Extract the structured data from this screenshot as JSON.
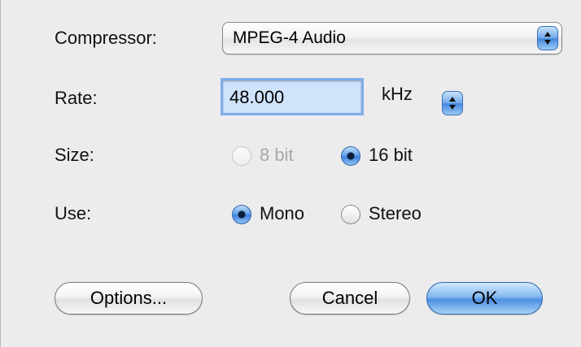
{
  "compressor": {
    "label": "Compressor:",
    "value": "MPEG-4 Audio"
  },
  "rate": {
    "label": "Rate:",
    "value": "48.000",
    "unit": "kHz"
  },
  "size": {
    "label": "Size:",
    "options": [
      {
        "label": "8 bit",
        "selected": false,
        "enabled": false
      },
      {
        "label": "16 bit",
        "selected": true,
        "enabled": true
      }
    ]
  },
  "use": {
    "label": "Use:",
    "options": [
      {
        "label": "Mono",
        "selected": true,
        "enabled": true
      },
      {
        "label": "Stereo",
        "selected": false,
        "enabled": true
      }
    ]
  },
  "buttons": {
    "options": "Options...",
    "cancel": "Cancel",
    "ok": "OK"
  }
}
